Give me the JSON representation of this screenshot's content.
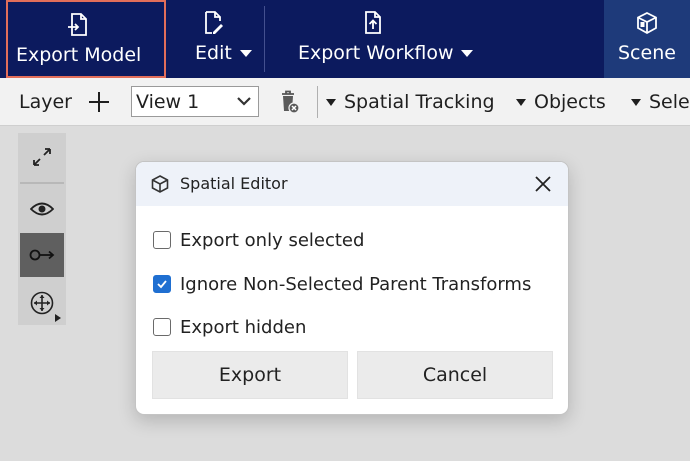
{
  "ribbon": {
    "export_model": {
      "label": "Export Model",
      "icon": "export-document-icon"
    },
    "edit": {
      "label": "Edit",
      "icon": "edit-document-icon"
    },
    "export_workflow": {
      "label": "Export Workflow",
      "icon": "upload-document-icon"
    },
    "scene": {
      "label": "Scene",
      "icon": "scene-cube-icon"
    },
    "colors": {
      "background": "#0c1a5e",
      "highlight_border": "#e36e5a",
      "scene_bg": "#1e3a7a"
    }
  },
  "toolbar": {
    "layer_label": "Layer",
    "add_icon": "plus-icon",
    "view_select": {
      "value": "View 1"
    },
    "delete_icon": "trash-icon",
    "dropdowns": [
      "Spatial Tracking",
      "Objects",
      "Sele"
    ]
  },
  "side_tools": [
    "expand-icon",
    "eye-icon",
    "link-icon",
    "move-icon"
  ],
  "dialog": {
    "title": "Spatial Editor",
    "icon": "cube-icon",
    "options": [
      {
        "label": "Export only selected",
        "checked": false
      },
      {
        "label": "Ignore Non-Selected Parent Transforms",
        "checked": true
      },
      {
        "label": "Export hidden",
        "checked": false
      }
    ],
    "buttons": {
      "export": "Export",
      "cancel": "Cancel"
    },
    "accent": "#1f6fd1"
  }
}
